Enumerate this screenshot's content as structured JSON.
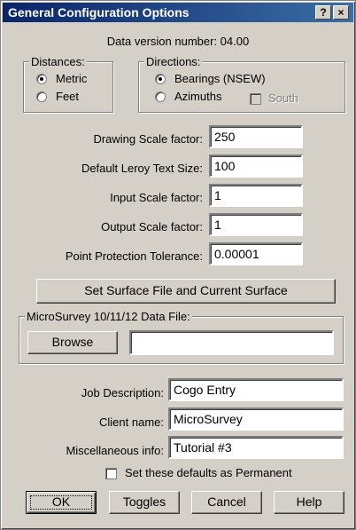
{
  "window": {
    "title": "General Configuration Options",
    "help_label": "?",
    "close_label": "×"
  },
  "data_version_label": "Data version number: 04.00",
  "distances": {
    "legend": "Distances:",
    "options": [
      {
        "label": "Metric",
        "selected": true
      },
      {
        "label": "Feet",
        "selected": false
      }
    ]
  },
  "directions": {
    "legend": "Directions:",
    "options": [
      {
        "label": "Bearings (NSEW)",
        "selected": true
      },
      {
        "label": "Azimuths",
        "selected": false
      }
    ],
    "south_label": "South",
    "south_checked": false
  },
  "fields": {
    "drawing_scale": {
      "label": "Drawing Scale factor:",
      "value": "250"
    },
    "leroy_text_size": {
      "label": "Default Leroy Text Size:",
      "value": "100"
    },
    "input_scale": {
      "label": "Input Scale factor:",
      "value": "1"
    },
    "output_scale": {
      "label": "Output Scale factor:",
      "value": "1"
    },
    "point_tolerance": {
      "label": "Point Protection Tolerance:",
      "value": "0.00001"
    }
  },
  "surface_button_label": "Set Surface File and Current Surface",
  "microsurvey_file": {
    "legend": "MicroSurvey 10/11/12 Data File:",
    "browse_label": "Browse",
    "path_value": ""
  },
  "job": {
    "description_label": "Job Description:",
    "description_value": "Cogo Entry",
    "client_label": "Client name:",
    "client_value": "MicroSurvey",
    "misc_label": "Miscellaneous info:",
    "misc_value": "Tutorial #3"
  },
  "permanent": {
    "label": "Set these defaults as Permanent",
    "checked": false
  },
  "buttons": {
    "ok": "OK",
    "toggles": "Toggles",
    "cancel": "Cancel",
    "help": "Help"
  }
}
